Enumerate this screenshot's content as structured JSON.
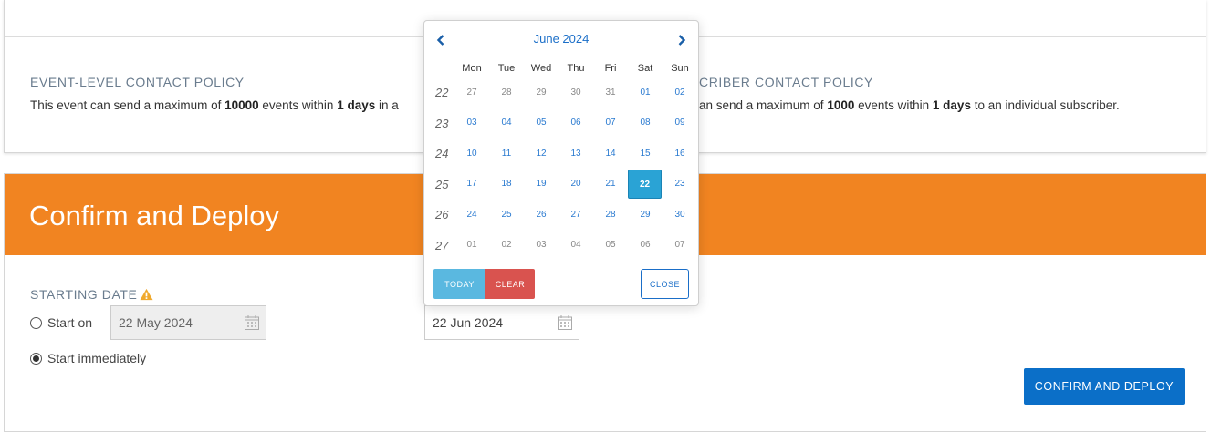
{
  "policies": {
    "event": {
      "title": "EVENT-LEVEL CONTACT POLICY",
      "text_prefix": "This event can send a maximum of ",
      "max_events": "10000",
      "text_mid": " events within ",
      "days": "1 days",
      "text_suffix": " in a"
    },
    "subscriber": {
      "title": "CRIBER CONTACT POLICY",
      "text_prefix": "an send a maximum of ",
      "max_events": "1000",
      "text_mid": " events within ",
      "days": "1 days",
      "text_suffix": " to an individual subscriber."
    }
  },
  "section": {
    "title": "Confirm and Deploy"
  },
  "starting_date": {
    "label": "STARTING DATE",
    "start_on_label": "Start on",
    "start_on_value": "22 May 2024",
    "start_immediately_label": "Start immediately",
    "second_date_value": "22 Jun 2024",
    "selected_option": "start_immediately"
  },
  "calendar": {
    "month_label": "June 2024",
    "weekdays": [
      "Mon",
      "Tue",
      "Wed",
      "Thu",
      "Fri",
      "Sat",
      "Sun"
    ],
    "weeks": [
      {
        "num": "22",
        "days": [
          "27",
          "28",
          "29",
          "30",
          "31",
          "01",
          "02"
        ],
        "other": [
          true,
          true,
          true,
          true,
          true,
          false,
          false
        ]
      },
      {
        "num": "23",
        "days": [
          "03",
          "04",
          "05",
          "06",
          "07",
          "08",
          "09"
        ],
        "other": [
          false,
          false,
          false,
          false,
          false,
          false,
          false
        ]
      },
      {
        "num": "24",
        "days": [
          "10",
          "11",
          "12",
          "13",
          "14",
          "15",
          "16"
        ],
        "other": [
          false,
          false,
          false,
          false,
          false,
          false,
          false
        ]
      },
      {
        "num": "25",
        "days": [
          "17",
          "18",
          "19",
          "20",
          "21",
          "22",
          "23"
        ],
        "other": [
          false,
          false,
          false,
          false,
          false,
          false,
          false
        ]
      },
      {
        "num": "26",
        "days": [
          "24",
          "25",
          "26",
          "27",
          "28",
          "29",
          "30"
        ],
        "other": [
          false,
          false,
          false,
          false,
          false,
          false,
          false
        ]
      },
      {
        "num": "27",
        "days": [
          "01",
          "02",
          "03",
          "04",
          "05",
          "06",
          "07"
        ],
        "other": [
          true,
          true,
          true,
          true,
          true,
          true,
          true
        ]
      }
    ],
    "selected_day": "22",
    "today_label": "TODAY",
    "clear_label": "CLEAR",
    "close_label": "CLOSE"
  },
  "actions": {
    "confirm_label": "CONFIRM AND DEPLOY"
  },
  "colors": {
    "accent_orange": "#f18421",
    "primary_blue": "#0b6fc8",
    "selected_day": "#2aa3d5",
    "clear_red": "#d9534f"
  }
}
